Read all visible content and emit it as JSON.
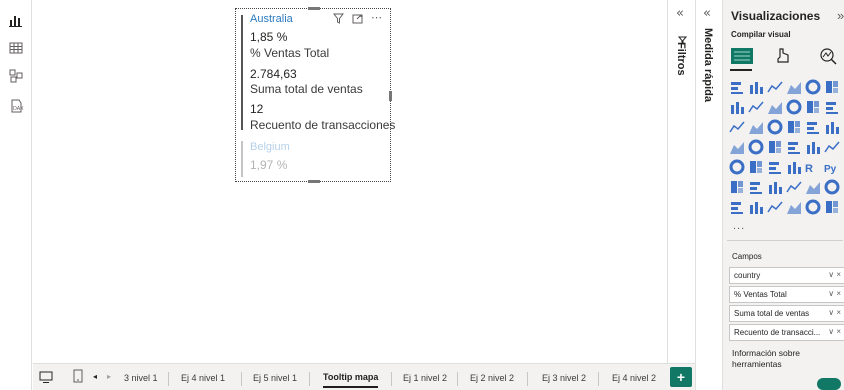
{
  "visual": {
    "cards": [
      {
        "country": "Australia",
        "pct_value": "1,85 %",
        "pct_label": "% Ventas Total",
        "sales_value": "2.784,63",
        "sales_label": "Suma total de ventas",
        "count_value": "12",
        "count_label": "Recuento de transacciones"
      },
      {
        "country": "Belgium",
        "pct_value": "1,97 %"
      }
    ],
    "header_icons": [
      "filter-icon",
      "focus-mode-icon",
      "more-options-icon"
    ]
  },
  "left_rail": {
    "icons": [
      "report-view-icon",
      "table-view-icon",
      "model-view-icon",
      "dax-query-icon"
    ]
  },
  "tabs": {
    "items": [
      "3 nivel 1",
      "Ej 4 nivel 1",
      "Ej 5 nivel 1",
      "Tooltip mapa",
      "Ej 1 nivel 2",
      "Ej 2 nivel 2",
      "Ej 3 nivel 2",
      "Ej 4 nivel 2"
    ],
    "active": "Tooltip mapa",
    "add_label": "+"
  },
  "panes": {
    "filters_label": "Filtros",
    "quick_measure_label": "Medida rápida",
    "collapse_glyph": "«"
  },
  "viz": {
    "title": "Visualizaciones",
    "expand_glyph": "»",
    "subtitle": "Compilar visual",
    "more": "...",
    "fields_title": "Campos",
    "fields": [
      {
        "label": "country"
      },
      {
        "label": "% Ventas Total"
      },
      {
        "label": "Suma total de ventas"
      },
      {
        "label": "Recuento de transacci..."
      }
    ],
    "field_controls": "∨ ×",
    "tooltip_info": "Información sobre herramientas",
    "r_label": "R",
    "py_label": "Py"
  },
  "colors": {
    "accent": "#117865",
    "country_link": "#2a7ac2",
    "viz_icon_blue": "#3b6fc6"
  }
}
